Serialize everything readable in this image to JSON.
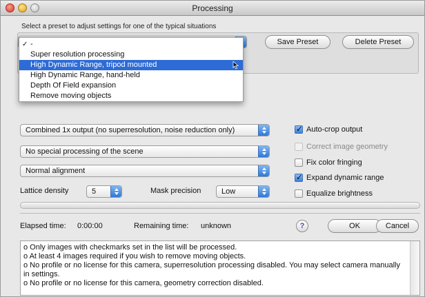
{
  "window": {
    "title": "Processing"
  },
  "presets": {
    "hint": "Select a preset to adjust settings for one of the typical situations",
    "save_label": "Save Preset",
    "delete_label": "Delete Preset",
    "menu": {
      "items": [
        {
          "label": "-",
          "checked": true,
          "check_mark": "✓"
        },
        {
          "label": "Super resolution processing"
        },
        {
          "label": "High Dynamic Range, tripod mounted",
          "highlighted": true
        },
        {
          "label": "High Dynamic Range, hand-held"
        },
        {
          "label": "Depth Of Field expansion"
        },
        {
          "label": "Remove moving objects"
        }
      ]
    }
  },
  "settings": {
    "output_mode": "Combined 1x output (no superresolution, noise reduction only)",
    "scene_processing": "No special processing of the scene",
    "alignment": "Normal alignment",
    "lattice_density_label": "Lattice density",
    "lattice_density_value": "5",
    "mask_precision_label": "Mask precision",
    "mask_precision_value": "Low"
  },
  "options": [
    {
      "label": "Auto-crop output",
      "checked": true,
      "enabled": true
    },
    {
      "label": "Correct image geometry",
      "checked": false,
      "enabled": false
    },
    {
      "label": "Fix color fringing",
      "checked": false,
      "enabled": true
    },
    {
      "label": "Expand dynamic range",
      "checked": true,
      "enabled": true
    },
    {
      "label": "Equalize brightness",
      "checked": false,
      "enabled": true
    }
  ],
  "status": {
    "elapsed_label": "Elapsed time:",
    "elapsed_value": "0:00:00",
    "remaining_label": "Remaining time:",
    "remaining_value": "unknown",
    "progress": 0
  },
  "buttons": {
    "help_label": "?",
    "ok_label": "OK",
    "cancel_label": "Cancel"
  },
  "log": {
    "lines": [
      "o   Only images with checkmarks set in the list will be processed.",
      "o   At least 4 images required if you wish to remove moving objects.",
      "o   No profile or no license for this camera, superresolution processing disabled. You may select camera manually in settings.",
      "o   No profile or no license for this camera, geometry correction disabled."
    ]
  },
  "colors": {
    "selection": "#2d6bd6",
    "popup_arrow": "#2e78d8"
  }
}
